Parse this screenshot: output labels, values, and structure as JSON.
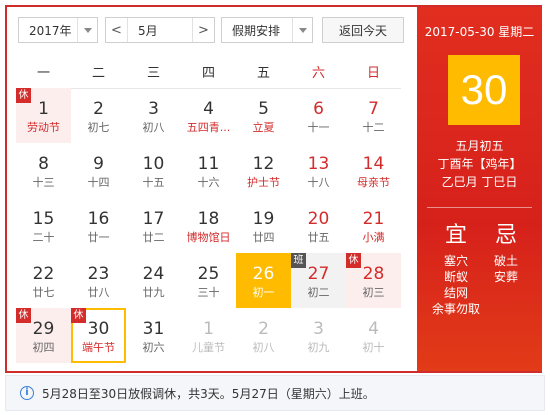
{
  "toolbar": {
    "year": "2017年",
    "prev_label": "<",
    "month": "5月",
    "next_label": ">",
    "holiday": "假期安排",
    "today": "返回今天"
  },
  "weekdays": [
    "一",
    "二",
    "三",
    "四",
    "五",
    "六",
    "日"
  ],
  "weeks": [
    [
      {
        "day": "1",
        "sub": "劳动节",
        "tag": "休",
        "state": "holiday",
        "subRed": true
      },
      {
        "day": "2",
        "sub": "初七"
      },
      {
        "day": "3",
        "sub": "初八"
      },
      {
        "day": "4",
        "sub": "五四青...",
        "subRed": true
      },
      {
        "day": "5",
        "sub": "立夏",
        "subRed": true
      },
      {
        "day": "6",
        "sub": "十一",
        "weekend": true
      },
      {
        "day": "7",
        "sub": "十二",
        "weekend": true
      }
    ],
    [
      {
        "day": "8",
        "sub": "十三"
      },
      {
        "day": "9",
        "sub": "十四"
      },
      {
        "day": "10",
        "sub": "十五"
      },
      {
        "day": "11",
        "sub": "十六"
      },
      {
        "day": "12",
        "sub": "护士节",
        "subRed": true
      },
      {
        "day": "13",
        "sub": "十八",
        "weekend": true
      },
      {
        "day": "14",
        "sub": "母亲节",
        "weekend": true,
        "subRed": true
      }
    ],
    [
      {
        "day": "15",
        "sub": "二十"
      },
      {
        "day": "16",
        "sub": "廿一"
      },
      {
        "day": "17",
        "sub": "廿二"
      },
      {
        "day": "18",
        "sub": "博物馆日",
        "subRed": true
      },
      {
        "day": "19",
        "sub": "廿四"
      },
      {
        "day": "20",
        "sub": "廿五",
        "weekend": true
      },
      {
        "day": "21",
        "sub": "小满",
        "weekend": true,
        "subRed": true
      }
    ],
    [
      {
        "day": "22",
        "sub": "廿七"
      },
      {
        "day": "23",
        "sub": "廿八"
      },
      {
        "day": "24",
        "sub": "廿九"
      },
      {
        "day": "25",
        "sub": "三十"
      },
      {
        "day": "26",
        "sub": "初一",
        "state": "selected"
      },
      {
        "day": "27",
        "sub": "初二",
        "tag": "班",
        "state": "workday",
        "weekend": true
      },
      {
        "day": "28",
        "sub": "初三",
        "tag": "休",
        "state": "holiday",
        "weekend": true
      }
    ],
    [
      {
        "day": "29",
        "sub": "初四",
        "tag": "休",
        "state": "holiday"
      },
      {
        "day": "30",
        "sub": "端午节",
        "tag": "休",
        "state": "today",
        "subRed": true
      },
      {
        "day": "31",
        "sub": "初六"
      },
      {
        "day": "1",
        "sub": "儿童节",
        "other": true
      },
      {
        "day": "2",
        "sub": "初八",
        "other": true
      },
      {
        "day": "3",
        "sub": "初九",
        "other": true
      },
      {
        "day": "4",
        "sub": "初十",
        "other": true
      }
    ]
  ],
  "panel": {
    "date": "2017-05-30 星期二",
    "day": "30",
    "lunar": "五月初五",
    "ganzhi_year": "丁酉年【鸡年】",
    "ganzhi_month_day": "乙巳月 丁巳日",
    "yi_label": "宜",
    "ji_label": "忌",
    "yi": [
      "塞穴",
      "断蚁",
      "结网",
      "余事勿取"
    ],
    "ji": [
      "破土",
      "安葬"
    ]
  },
  "footer": {
    "icon": "info-icon",
    "text": "5月28日至30日放假调休，共3天。5月27日（星期六）上班。"
  },
  "colors": {
    "accent_red": "#d42b2b",
    "selected": "#ffbb00"
  }
}
